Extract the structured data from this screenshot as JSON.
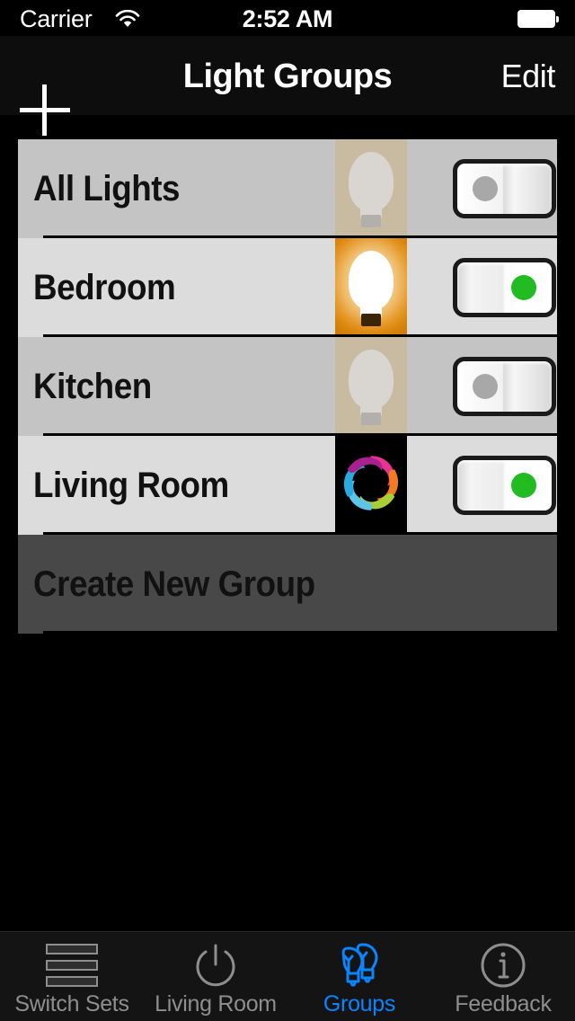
{
  "status_bar": {
    "carrier": "Carrier",
    "time": "2:52 AM",
    "wifi_icon": "wifi-icon",
    "battery_icon": "battery-full-icon"
  },
  "nav_bar": {
    "title": "Light Groups",
    "add_label": "+",
    "add_icon": "plus-icon",
    "edit_label": "Edit"
  },
  "colors": {
    "accent": "#0a84ff",
    "toggle_on": "#22bb22",
    "toggle_off": "#a8a8a8",
    "row_odd": "#c4c4c4",
    "row_even": "#dcdcdc",
    "create_row": "#484848",
    "bulb_on_bg": "#e8920e",
    "bulb_off_bg": "#c9bba2"
  },
  "groups": [
    {
      "name": "All Lights",
      "state": "off",
      "thumb": "bulb-off-icon",
      "toggle": "switch-off"
    },
    {
      "name": "Bedroom",
      "state": "on",
      "thumb": "bulb-on-icon",
      "toggle": "switch-on"
    },
    {
      "name": "Kitchen",
      "state": "off",
      "thumb": "bulb-off-icon",
      "toggle": "switch-off"
    },
    {
      "name": "Living Room",
      "state": "on",
      "thumb": "color-swirl-icon",
      "toggle": "switch-on"
    }
  ],
  "create_row": {
    "label": "Create New Group"
  },
  "tab_bar": {
    "items": [
      {
        "label": "Switch Sets",
        "icon": "stacked-bars-icon",
        "active": false
      },
      {
        "label": "Living Room",
        "icon": "power-icon",
        "active": false
      },
      {
        "label": "Groups",
        "icon": "two-bulbs-icon",
        "active": true
      },
      {
        "label": "Feedback",
        "icon": "info-circle-icon",
        "active": false
      }
    ]
  }
}
